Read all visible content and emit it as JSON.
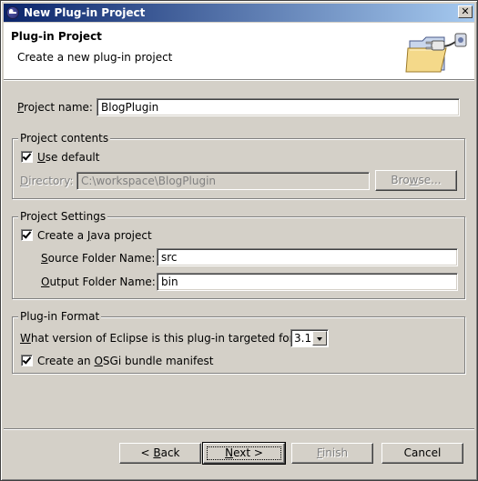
{
  "window": {
    "title": "New Plug-in Project",
    "close_glyph": "✕",
    "icon": "eclipse-icon"
  },
  "banner": {
    "title": "Plug-in Project",
    "description": "Create a new plug-in project",
    "icon": "folder-plug-icon"
  },
  "project_name": {
    "label_mnemonic": "P",
    "label_rest": "roject name:",
    "value": "BlogPlugin"
  },
  "project_contents": {
    "legend": "Project contents",
    "use_default": {
      "label_mnemonic": "U",
      "label_rest": "se default",
      "checked": true
    },
    "directory": {
      "label_mnemonic": "D",
      "label_rest": "irectory:",
      "value": "C:\\workspace\\BlogPlugin"
    },
    "browse_mnemonic": "w",
    "browse_before": "Bro",
    "browse_after": "se..."
  },
  "project_settings": {
    "legend": "Project Settings",
    "create_java": {
      "label_before": "Create a ",
      "label_mnemonic": "J",
      "label_after": "ava project",
      "checked": true
    },
    "source_folder": {
      "label_mnemonic": "S",
      "label_rest": "ource Folder Name:",
      "value": "src"
    },
    "output_folder": {
      "label_mnemonic": "O",
      "label_rest": "utput Folder Name:",
      "value": "bin"
    }
  },
  "plugin_format": {
    "legend": "Plug-in Format",
    "version": {
      "label_mnemonic": "W",
      "label_rest": "hat version of Eclipse is this plug-in targeted for?",
      "value": "3.1"
    },
    "osgi": {
      "label_before": "Create an ",
      "label_mnemonic": "O",
      "label_after": "SGi bundle manifest",
      "checked": true
    }
  },
  "buttons": {
    "back_before": "< ",
    "back_mnemonic": "B",
    "back_after": "ack",
    "next_mnemonic": "N",
    "next_after": "ext >",
    "finish_mnemonic": "F",
    "finish_after": "inish",
    "cancel": "Cancel"
  },
  "colors": {
    "title_start": "#0a246a",
    "title_end": "#a6caf0",
    "face": "#d4d0c8"
  }
}
